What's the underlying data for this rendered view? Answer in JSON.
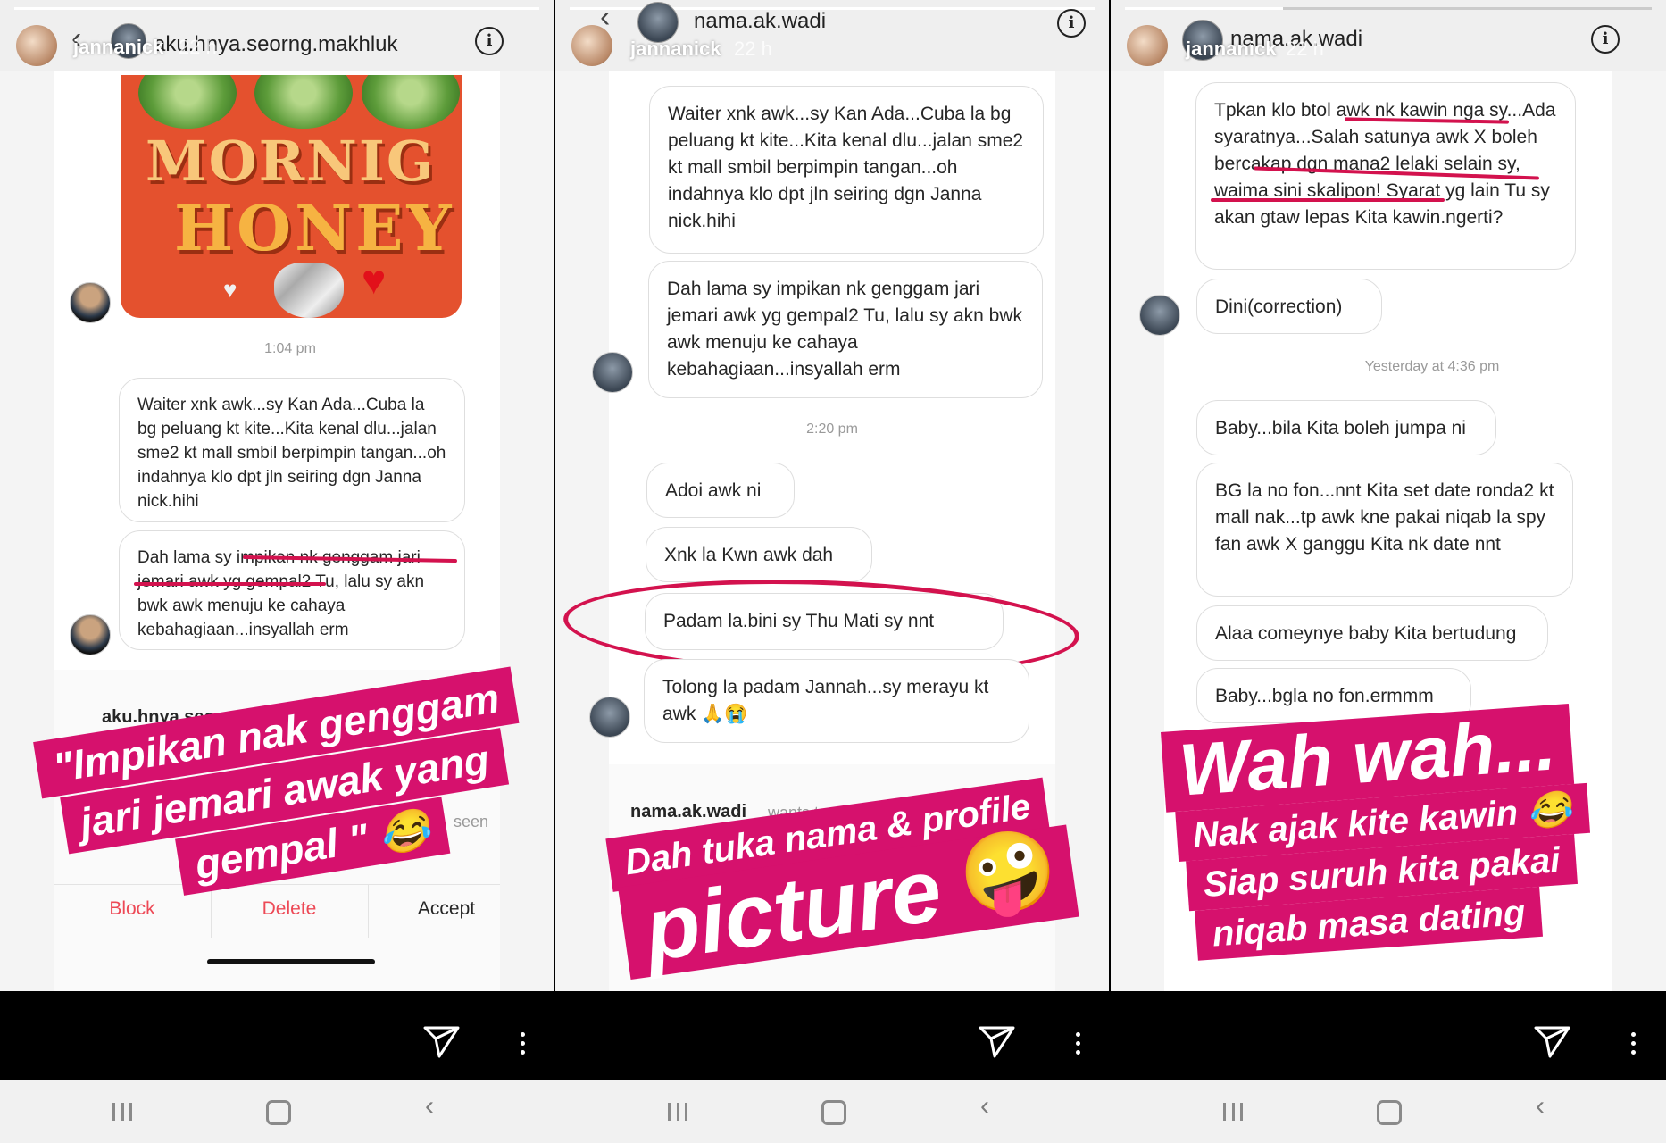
{
  "panel1": {
    "story_user": "jannanick",
    "story_time": "22 h",
    "chat_title": "aku.hnya.seorng.makhluk",
    "sticker_line1": "MORNIG",
    "sticker_line2": "HONEY",
    "timestamp": "1:04 pm",
    "messages": [
      "Waiter xnk awk...sy Kan Ada...Cuba la bg peluang kt kite...Kita kenal dlu...jalan sme2 kt mall smbil berpimpin tangan...oh indahnya klo dpt jln seiring dgn Janna nick.hihi",
      "Dah lama sy impikan nk genggam jari jemari awk yg gempal2 Tu, lalu sy akn bwk awk menuju ke cahaya kebahagiaan...insyallah erm"
    ],
    "request_name": "aku.hnya.seorng.makhluk",
    "request_dim": "seen",
    "buttons": {
      "block": "Block",
      "delete": "Delete",
      "accept": "Accept"
    },
    "caption_lines": [
      "\"Impikan nak genggam",
      "jari jemari awak yang",
      "gempal \" 😂"
    ]
  },
  "panel2": {
    "story_user": "jannanick",
    "story_time": "22 h",
    "chat_title": "nama.ak.wadi",
    "messages": [
      "Waiter xnk awk...sy Kan Ada...Cuba la bg peluang kt kite...Kita kenal dlu...jalan sme2 kt mall smbil berpimpin tangan...oh indahnya klo dpt jln seiring dgn Janna nick.hihi",
      "Dah lama sy impikan nk genggam jari jemari awk yg gempal2 Tu, lalu sy akn bwk awk menuju ke cahaya kebahagiaan...insyallah erm"
    ],
    "timestamp": "2:20 pm",
    "short_messages": [
      "Adoi awk ni",
      "Xnk la Kwn awk dah",
      "Padam la.bini sy Thu Mati sy nnt",
      "Tolong la padam Jannah...sy merayu kt awk 🙏😭"
    ],
    "request_name": "nama.ak.wadi",
    "request_dim": "wants to",
    "caption_small": "Dah tuka nama & profile",
    "caption_big": "picture",
    "caption_emoji": "🤪"
  },
  "panel3": {
    "story_user": "jannanick",
    "story_time": "22 h",
    "chat_title": "nama.ak.wadi",
    "messages": [
      "Tpkan klo btol awk nk kawin nga sy...Ada syaratnya...Salah satunya awk X boleh bercakap dgn mana2 lelaki selain sy, waima sini skalipon! Syarat yg lain Tu sy akan gtaw lepas Kita kawin.ngerti?",
      "Dini(correction)",
      "Baby...bila Kita boleh jumpa ni",
      "BG la no fon...nnt Kita set date ronda2 kt mall nak...tp awk kne pakai niqab la spy fan awk X ganggu Kita nk date nnt",
      "Alaa comeynye baby Kita bertudung",
      "Baby...bgla no fon.ermmm"
    ],
    "timestamp": "Yesterday at 4:36 pm",
    "caption_big": "Wah wah...",
    "caption_lines": [
      "Nak ajak kite kawin 😂",
      "Siap suruh kita pakai",
      "niqab masa dating"
    ]
  },
  "colors": {
    "caption_bg": "#d6116d",
    "annotation": "#d3124e"
  }
}
